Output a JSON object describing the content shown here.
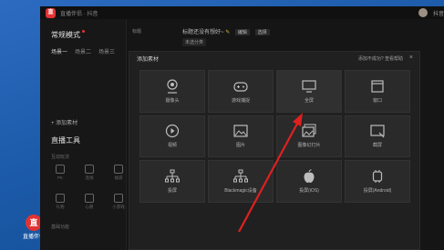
{
  "window": {
    "logo_text": "直",
    "title": "直播伴侣 · 抖音",
    "user_label": "抖音"
  },
  "desktop": {
    "icon_label": "直播伴侣"
  },
  "sidebar": {
    "mode_title": "常规模式",
    "scenes": [
      "场景一",
      "场景二",
      "场景三"
    ],
    "add_source": "+ 添加素材",
    "live_title": "直播工具",
    "section_interaction": "互动玩法",
    "section_basic": "基础功能",
    "tools": [
      {
        "label": "PK",
        "icon": "pk-icon"
      },
      {
        "label": "连线",
        "icon": "link-icon"
      },
      {
        "label": "福袋",
        "icon": "bag-icon"
      },
      {
        "label": "礼物",
        "icon": "gift-icon"
      },
      {
        "label": "心愿",
        "icon": "heart-icon"
      },
      {
        "label": "小游戏",
        "icon": "game-icon"
      }
    ]
  },
  "topbar": {
    "left_label": "标题",
    "stream_title": "标题还没有想好~",
    "edit_btn": "编辑",
    "select_btn": "选择",
    "category": "未选分类"
  },
  "panel": {
    "title": "添加素材",
    "help": "添加不成功? 查看帮助",
    "close": "×",
    "items": [
      {
        "label": "摄像头",
        "icon": "camera-icon"
      },
      {
        "label": "游戏捕捉",
        "icon": "gamepad-icon"
      },
      {
        "label": "全屏",
        "icon": "monitor-icon"
      },
      {
        "label": "窗口",
        "icon": "window-icon"
      },
      {
        "label": "视频",
        "icon": "video-icon"
      },
      {
        "label": "图片",
        "icon": "image-icon"
      },
      {
        "label": "图像幻灯片",
        "icon": "slideshow-icon"
      },
      {
        "label": "截屏",
        "icon": "screenshot-icon"
      },
      {
        "label": "投屏",
        "icon": "network-icon"
      },
      {
        "label": "Blackmagic设备",
        "icon": "blackmagic-icon"
      },
      {
        "label": "投屏(iOS)",
        "icon": "apple-icon"
      },
      {
        "label": "投屏(Android)",
        "icon": "android-icon"
      }
    ]
  },
  "colors": {
    "accent": "#e23232",
    "arrow": "#e02020"
  }
}
